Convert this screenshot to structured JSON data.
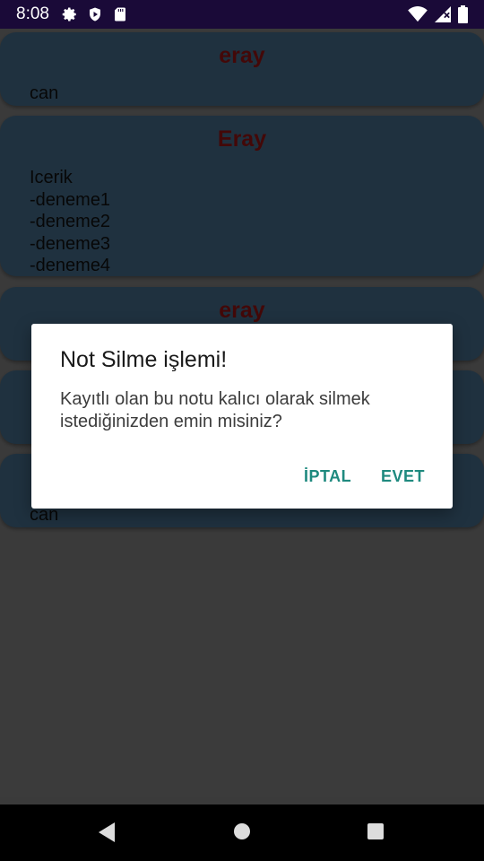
{
  "status_bar": {
    "time": "8:08",
    "icons": [
      "gear-icon",
      "play-protect-icon",
      "sd-card-icon",
      "wifi-icon",
      "signal-icon",
      "battery-icon"
    ]
  },
  "notes": [
    {
      "title": "eray",
      "content": "can"
    },
    {
      "title": "Eray",
      "content": "Icerik\n-deneme1\n-deneme2\n-deneme3\n-deneme4"
    },
    {
      "title": "eray",
      "content": ""
    },
    {
      "title": "",
      "content": ""
    },
    {
      "title": "",
      "content": "can"
    }
  ],
  "dialog": {
    "title": "Not Silme işlemi!",
    "message": "Kayıtlı olan bu notu kalıcı olarak silmek istediğinizden emin misiniz?",
    "cancel_label": "İPTAL",
    "confirm_label": "EVET"
  },
  "nav_bar": {
    "buttons": [
      "back-icon",
      "home-icon",
      "recents-icon"
    ]
  },
  "colors": {
    "card": "#395a73",
    "title_text": "#7a0f10",
    "dialog_button": "#1f8a7f",
    "scrim": "#6b6b6b",
    "status_bar": "#1a0a38"
  }
}
